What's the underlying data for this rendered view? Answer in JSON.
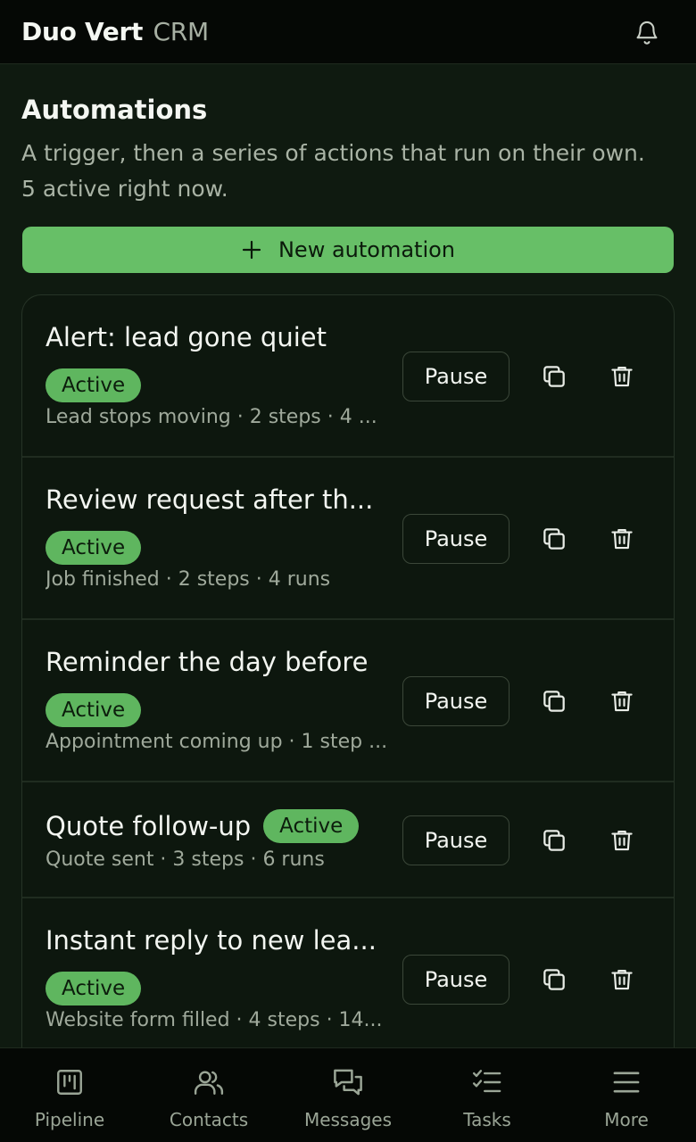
{
  "app": {
    "brand_main": "Duo Vert",
    "brand_sub": "CRM"
  },
  "header": {
    "title": "Automations",
    "description_line1": "A trigger, then a series of actions that run on their own.",
    "description_line2": "5 active right now.",
    "new_button_label": "New automation"
  },
  "automations": [
    {
      "name": "Alert: lead gone quiet",
      "status": "Active",
      "meta": "Lead stops moving · 2 steps · 4 ...",
      "pause_label": "Pause"
    },
    {
      "name": "Review request after th...",
      "status": "Active",
      "meta": "Job finished · 2 steps · 4 runs",
      "pause_label": "Pause"
    },
    {
      "name": "Reminder the day before",
      "status": "Active",
      "meta": "Appointment coming up · 1 step ...",
      "pause_label": "Pause"
    },
    {
      "name": "Quote follow-up",
      "status": "Active",
      "meta": "Quote sent · 3 steps · 6 runs",
      "pause_label": "Pause"
    },
    {
      "name": "Instant reply to new lea...",
      "status": "Active",
      "meta": "Website form filled · 4 steps · 14...",
      "pause_label": "Pause"
    }
  ],
  "nav": [
    {
      "label": "Pipeline",
      "icon": "pipeline-icon"
    },
    {
      "label": "Contacts",
      "icon": "contacts-icon"
    },
    {
      "label": "Messages",
      "icon": "messages-icon"
    },
    {
      "label": "Tasks",
      "icon": "tasks-icon"
    },
    {
      "label": "More",
      "icon": "menu-icon"
    }
  ],
  "colors": {
    "accent": "#67bf67",
    "background": "#0f1a10",
    "bar": "#050805"
  }
}
